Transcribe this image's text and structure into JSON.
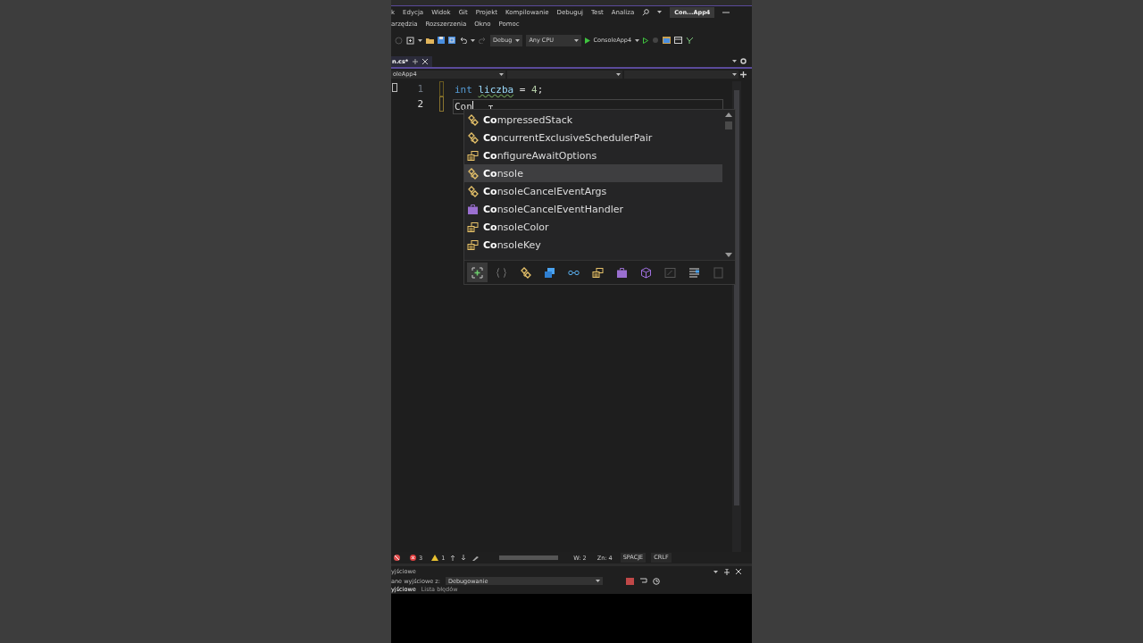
{
  "title_badge": "Con...App4",
  "menu_rows": [
    [
      "k",
      "Edycja",
      "Widok",
      "Git",
      "Projekt",
      "Kompilowanie",
      "Debuguj",
      "Test",
      "Analiza"
    ],
    [
      "arzędzia",
      "Rozszerzenia",
      "Okno",
      "Pomoc"
    ]
  ],
  "toolbar": {
    "configuration": "Debug",
    "platform": "Any CPU",
    "start_target": "ConsoleApp4"
  },
  "editor_tab": {
    "label": "n.cs*"
  },
  "nav_bar": {
    "project": "oleApp4"
  },
  "code_lines": [
    {
      "number": "1",
      "current": false,
      "tokens": [
        {
          "kind": "keyword",
          "text": "int"
        },
        {
          "kind": "identifier",
          "text": "liczba",
          "warning": true
        },
        {
          "kind": "plain",
          "text": " = "
        },
        {
          "kind": "number",
          "text": "4"
        },
        {
          "kind": "plain",
          "text": ";"
        }
      ]
    },
    {
      "number": "2",
      "current": true,
      "tokens": [
        {
          "kind": "plain",
          "text": "Con"
        }
      ]
    }
  ],
  "completion": {
    "items": [
      {
        "kind": "class",
        "label": "**Co**mpressedStack",
        "selected": false
      },
      {
        "kind": "class",
        "label": "**Co**ncurrentExclusiveSchedulerPair",
        "selected": false
      },
      {
        "kind": "enum",
        "label": "**Co**nfigureAwaitOptions",
        "selected": false
      },
      {
        "kind": "class",
        "label": "**Co**nsole",
        "selected": true
      },
      {
        "kind": "class",
        "label": "**Co**nsoleCancelEventArgs",
        "selected": false
      },
      {
        "kind": "delegate",
        "label": "**Co**nsoleCancelEventHandler",
        "selected": false
      },
      {
        "kind": "enum",
        "label": "**Co**nsoleColor",
        "selected": false
      },
      {
        "kind": "enum",
        "label": "**Co**nsoleKey",
        "selected": false
      }
    ],
    "filters": [
      {
        "kind": "expand",
        "selected": true
      },
      {
        "kind": "namespace",
        "selected": false
      },
      {
        "kind": "class",
        "selected": false
      },
      {
        "kind": "struct",
        "selected": false
      },
      {
        "kind": "interface",
        "selected": false
      },
      {
        "kind": "enum",
        "selected": false
      },
      {
        "kind": "delegate",
        "selected": false
      },
      {
        "kind": "module",
        "selected": false
      },
      {
        "kind": "snippet",
        "selected": false
      },
      {
        "kind": "keyword",
        "selected": false
      },
      {
        "kind": "blank",
        "selected": false
      }
    ]
  },
  "status_bar": {
    "errors": "3",
    "warnings": "1",
    "line": "W: 2",
    "column": "Zn: 4",
    "indent": "SPACJE",
    "line_ending": "CRLF"
  },
  "output_panel": {
    "title": "yjściowe",
    "source_label": "ane wyjściowe z:",
    "source": "Debugowanie",
    "tabs": [
      {
        "label": "yjściowe",
        "selected": true
      },
      {
        "label": "Lista błędów",
        "selected": false
      }
    ]
  }
}
